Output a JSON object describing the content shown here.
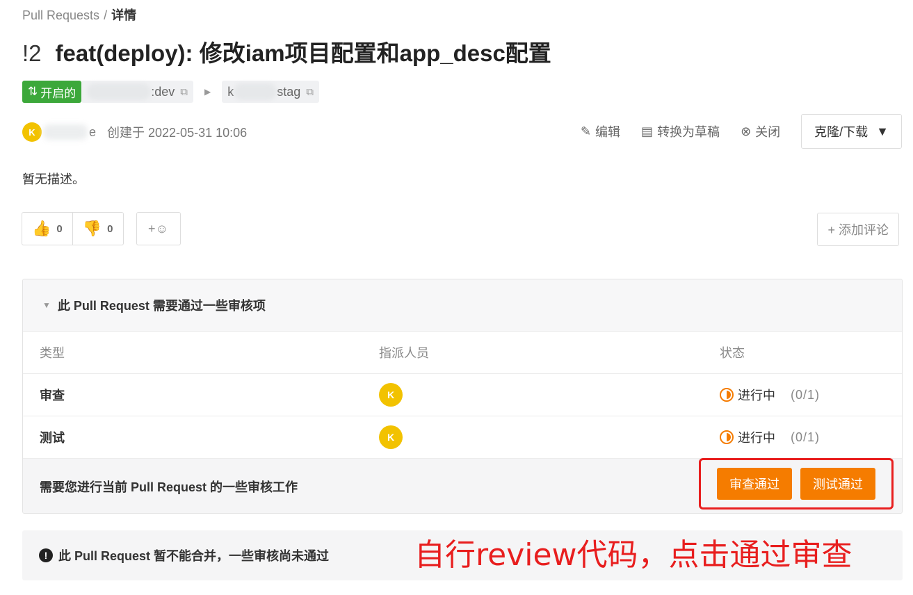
{
  "breadcrumb": {
    "parent": "Pull Requests",
    "separator": "/",
    "current": "详情"
  },
  "pr": {
    "number": "!2",
    "title": "feat(deploy): 修改iam项目配置和app_desc配置",
    "state_label": "开启的",
    "source_branch_suffix": ":dev",
    "target_branch_prefix": "k",
    "target_branch_suffix": "stag"
  },
  "author": {
    "avatar_initial": "K",
    "name_suffix": "e",
    "created_text": "创建于 2022-05-31 10:06"
  },
  "actions": {
    "edit": "编辑",
    "draft": "转换为草稿",
    "close": "关闭",
    "clone": "克隆/下载"
  },
  "description": "暂无描述。",
  "reactions": {
    "thumbs_up": "0",
    "thumbs_down": "0",
    "add_emoji": "+"
  },
  "add_comment": "+ 添加评论",
  "review": {
    "header": "此 Pull Request 需要通过一些审核项",
    "columns": {
      "type": "类型",
      "assignee": "指派人员",
      "status": "状态"
    },
    "rows": [
      {
        "type": "审查",
        "assignee_initial": "K",
        "status": "进行中",
        "count": "(0/1)"
      },
      {
        "type": "测试",
        "assignee_initial": "K",
        "status": "进行中",
        "count": "(0/1)"
      }
    ],
    "footer_text": "需要您进行当前 Pull Request 的一些审核工作",
    "approve_review": "审查通过",
    "approve_test": "测试通过"
  },
  "merge_status": "此 Pull Request 暂不能合并，一些审核尚未通过",
  "annotation": "自行review代码，点击通过审查",
  "colors": {
    "accent": "#f57c00",
    "open_badge": "#3ca83a",
    "annotation": "#e81e1e"
  }
}
